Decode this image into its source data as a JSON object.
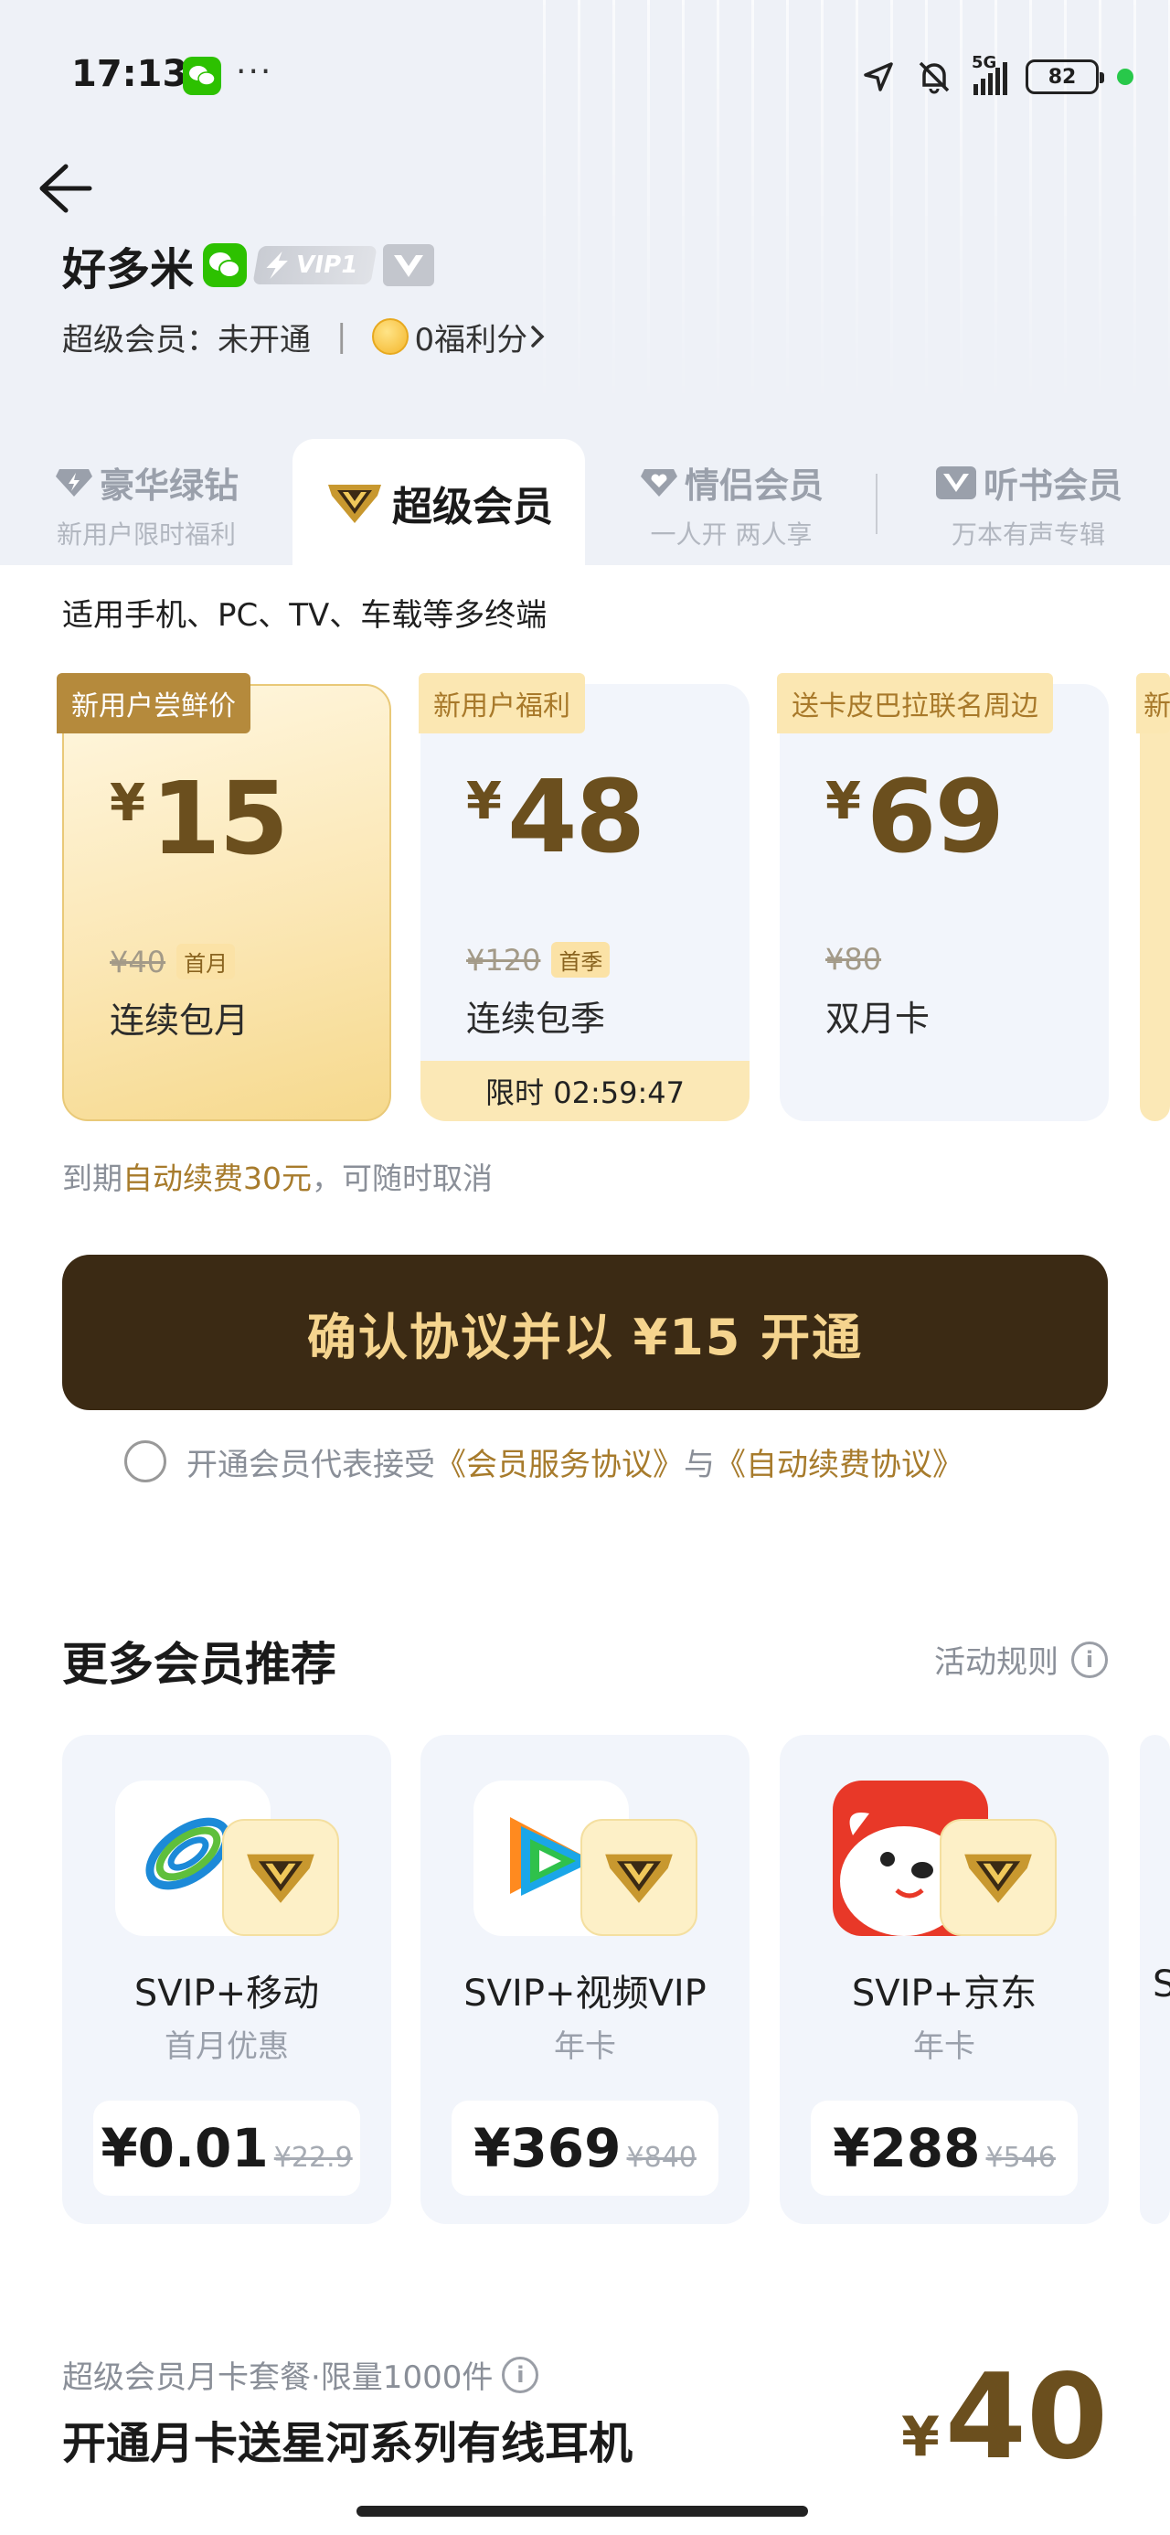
{
  "status_bar": {
    "time": "17:13",
    "dots": "···",
    "network": "5G",
    "battery": "82"
  },
  "header": {
    "username": "好多米",
    "vip_level": "VIP1",
    "membership_label": "超级会员：未开通",
    "points": "0福利分"
  },
  "tabs": [
    {
      "title": "豪华绿钻",
      "sub": "新用户限时福利"
    },
    {
      "title": "超级会员",
      "sub": ""
    },
    {
      "title": "情侣会员",
      "sub": "一人开 两人享"
    },
    {
      "title": "听书会员",
      "sub": "万本有声专辑"
    }
  ],
  "terminals_note": "适用手机、PC、TV、车载等多终端",
  "plans": [
    {
      "tag": "新用户尝鲜价",
      "currency": "¥",
      "price": "15",
      "original": "¥40",
      "badge": "首月",
      "name": "连续包月",
      "timer": ""
    },
    {
      "tag": "新用户福利",
      "currency": "¥",
      "price": "48",
      "original": "¥120",
      "badge": "首季",
      "name": "连续包季",
      "timer": "限时 02:59:47"
    },
    {
      "tag": "送卡皮巴拉联名周边",
      "currency": "¥",
      "price": "69",
      "original": "¥80",
      "badge": "",
      "name": "双月卡",
      "timer": ""
    },
    {
      "tag": "新",
      "currency": "",
      "price": "",
      "original": "",
      "badge": "",
      "name": "",
      "timer": ""
    }
  ],
  "renew_note": {
    "prefix": "到期",
    "highlight": "自动续费30元",
    "suffix": "，可随时取消"
  },
  "cta_label": "确认协议并以 ¥15 开通",
  "agreement": {
    "prefix": "开通会员代表接受",
    "link1": "《会员服务协议》",
    "mid": "与",
    "link2": "《自动续费协议》"
  },
  "more": {
    "title": "更多会员推荐",
    "rules": "活动规则",
    "items": [
      {
        "name": "SVIP+移动",
        "sub": "首月优惠",
        "price": "¥0.01",
        "original": "¥22.9",
        "logo": "china-mobile-icon"
      },
      {
        "name": "SVIP+视频VIP",
        "sub": "年卡",
        "price": "¥369",
        "original": "¥840",
        "logo": "tencent-video-icon"
      },
      {
        "name": "SVIP+京东",
        "sub": "年卡",
        "price": "¥288",
        "original": "¥546",
        "logo": "jd-joy-icon"
      },
      {
        "name": "S",
        "sub": "",
        "price": "",
        "original": "",
        "logo": ""
      }
    ]
  },
  "bundle": {
    "sub": "超级会员月卡套餐·限量1000件",
    "title": "开通月卡送星河系列有线耳机",
    "currency": "¥",
    "price": "40"
  },
  "colors": {
    "accent_gold": "#a77b2c",
    "cta_bg": "#3b2a14",
    "cta_text": "#f5d48e"
  }
}
